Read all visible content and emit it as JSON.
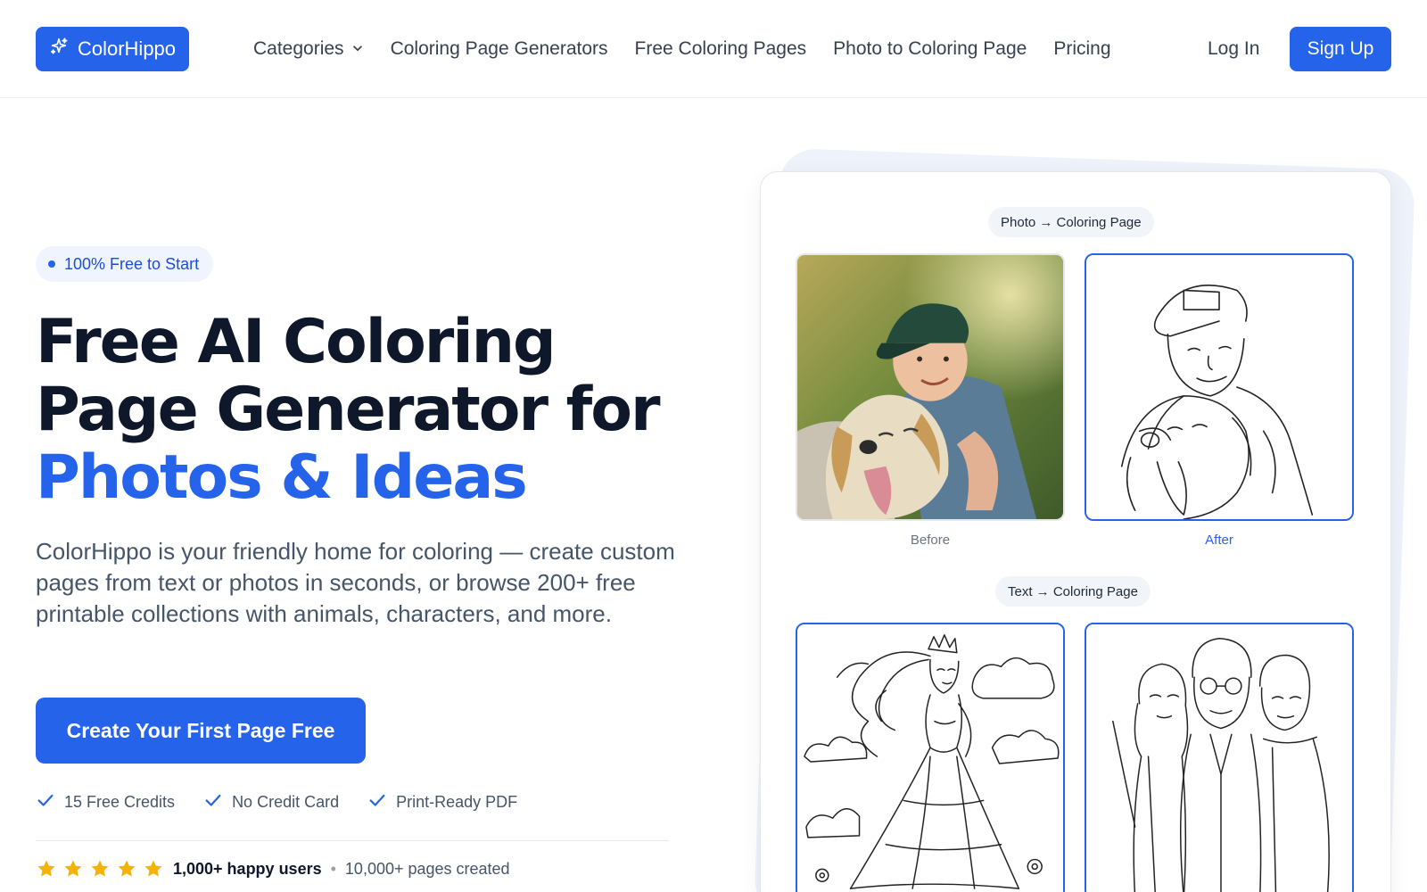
{
  "nav": {
    "logo_text": "ColorHippo",
    "links": [
      {
        "label": "Categories",
        "has_dropdown": true
      },
      {
        "label": "Coloring Page Generators"
      },
      {
        "label": "Free Coloring Pages"
      },
      {
        "label": "Photo to Coloring Page"
      },
      {
        "label": "Pricing"
      }
    ],
    "login": "Log In",
    "signup": "Sign Up"
  },
  "hero": {
    "badge": "100% Free to Start",
    "headline_line1": "Free AI Coloring",
    "headline_line2": "Page Generator for",
    "headline_accent": "Photos & Ideas",
    "description": "ColorHippo is your friendly home for coloring — create custom pages from text or photos in seconds, or browse 200+ free printable collections with animals, characters, and more.",
    "cta": "Create Your First Page Free",
    "features": [
      "15 Free Credits",
      "No Credit Card",
      "Print-Ready PDF"
    ],
    "rating_stars": 5,
    "happy_users": "1,000+ happy users",
    "pages_created": "10,000+ pages created"
  },
  "showcase": {
    "photo_label": "Photo → Coloring Page",
    "before_caption": "Before",
    "after_caption": "After",
    "text_label": "Text → Coloring Page"
  },
  "colors": {
    "brand": "#2563eb",
    "heading": "#0f172a",
    "body_text": "#475569",
    "star": "#f5b301"
  }
}
